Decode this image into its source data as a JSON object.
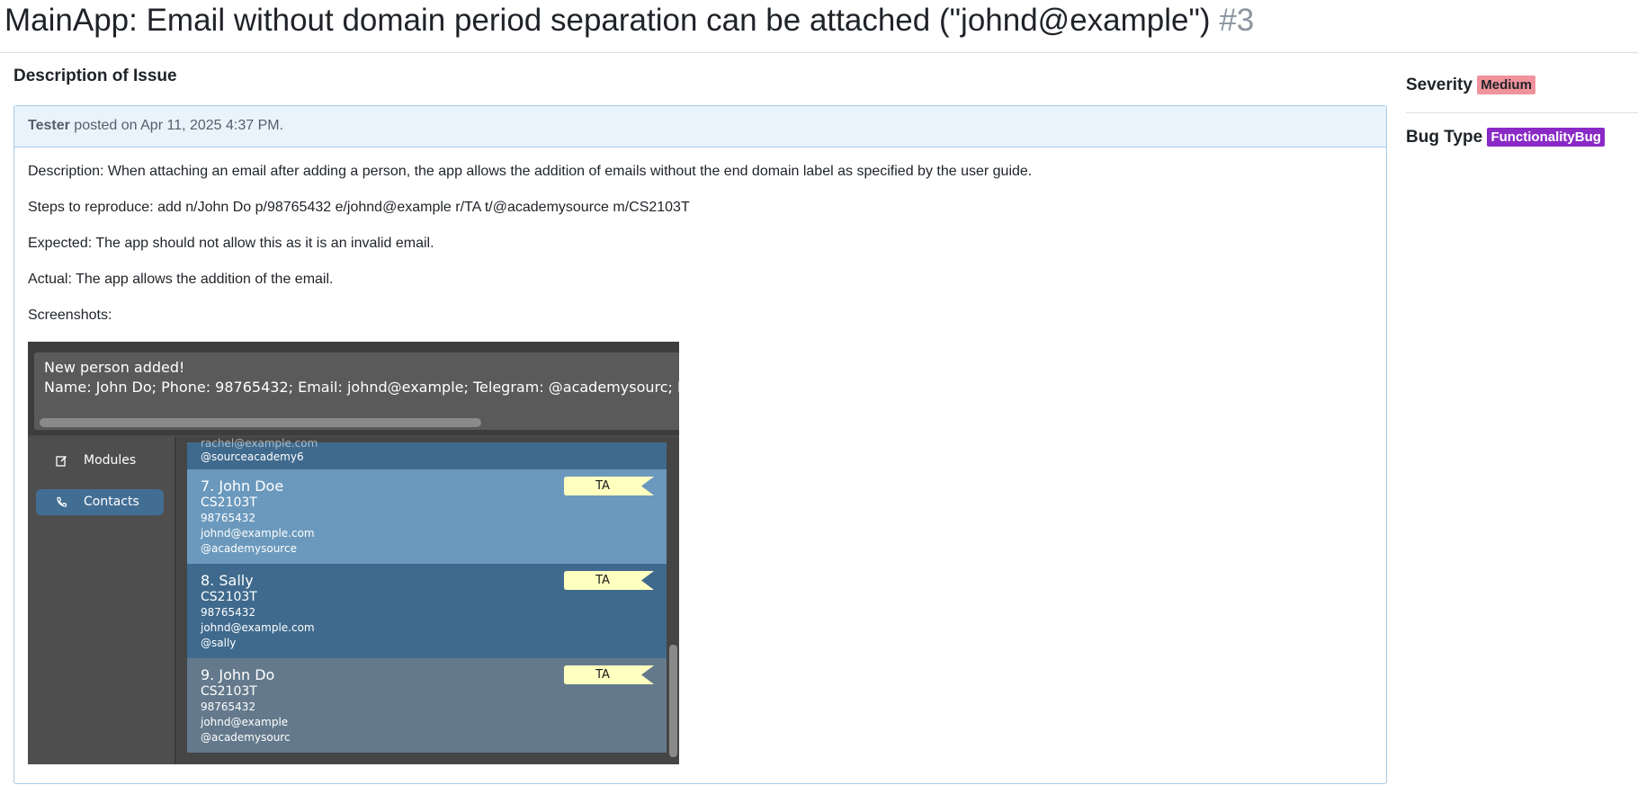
{
  "issue": {
    "title": "MainApp: Email without domain period separation can be attached (\"johnd@example\")",
    "number": "#3"
  },
  "section_title": "Description of Issue",
  "comment": {
    "author": "Tester",
    "posted_text": " posted on Apr 11, 2025 4:37 PM.",
    "paragraphs": [
      "Description: When attaching an email after adding a person, the app allows the addition of emails without the end domain label as specified by the user guide.",
      "Steps to reproduce: add n/John Do p/98765432 e/johnd@example r/TA t/@academysource m/CS2103T",
      "Expected: The app should not allow this as it is an invalid email.",
      "Actual: The app allows the addition of the email.",
      "Screenshots:"
    ]
  },
  "screenshot": {
    "result_line1": "New person added!",
    "result_line2": "Name: John Do; Phone: 98765432; Email: johnd@example; Telegram: @academysourc; Role: TA;",
    "nav": {
      "modules_label": "Modules",
      "contacts_label": "Contacts"
    },
    "partial_card": {
      "email": "rachel@example.com",
      "telegram": "@sourceacademy6"
    },
    "cards": [
      {
        "name": "7. John Doe",
        "module": "CS2103T",
        "phone": "98765432",
        "email": "johnd@example.com",
        "telegram": "@academysource",
        "tag": "TA"
      },
      {
        "name": "8. Sally",
        "module": "CS2103T",
        "phone": "98765432",
        "email": "johnd@example.com",
        "telegram": "@sally",
        "tag": "TA"
      },
      {
        "name": "9. John Do",
        "module": "CS2103T",
        "phone": "98765432",
        "email": "johnd@example",
        "telegram": "@academysourc",
        "tag": "TA"
      }
    ],
    "colors": {
      "selected_nav": "#436e94",
      "card_selected": "#6b99bd",
      "card_dark": "#3f6a8d",
      "card_grey": "#647a8c",
      "tag_fill": "#ffffc0"
    }
  },
  "sidebar": {
    "severity_label": "Severity",
    "severity_value": "Medium",
    "bug_type_label": "Bug Type",
    "bug_type_value": "FunctionalityBug",
    "colors": {
      "severity_badge": "#f0929b",
      "bug_type_badge": "#8a2ac6"
    }
  }
}
